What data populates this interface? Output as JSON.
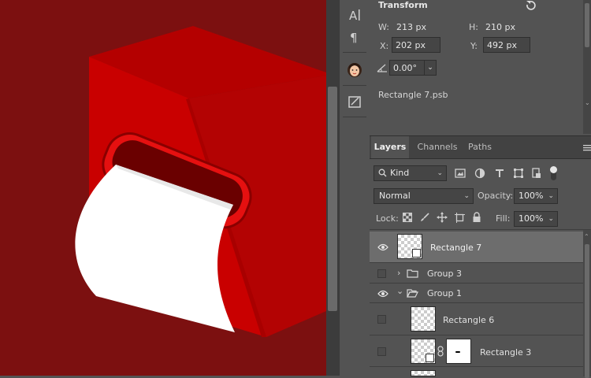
{
  "properties": {
    "section_title": "Transform",
    "w_label": "W:",
    "w_value": "213 px",
    "h_label": "H:",
    "h_value": "210 px",
    "x_label": "X:",
    "x_value": "202 px",
    "y_label": "Y:",
    "y_value": "492 px",
    "angle_value": "0.00°",
    "linked_file": "Rectangle 7.psb"
  },
  "layers_panel": {
    "tabs": [
      "Layers",
      "Channels",
      "Paths"
    ],
    "filter_kind": "Kind",
    "blend_mode": "Normal",
    "opacity_label": "Opacity:",
    "opacity_value": "100%",
    "lock_label": "Lock:",
    "fill_label": "Fill:",
    "fill_value": "100%",
    "layers": [
      {
        "name": "Rectangle 7",
        "visible": true,
        "selected": true,
        "kind": "smart-object"
      },
      {
        "name": "Group 3",
        "visible": false,
        "kind": "group",
        "expanded": false
      },
      {
        "name": "Group 1",
        "visible": true,
        "kind": "group",
        "expanded": true
      },
      {
        "name": "Rectangle 6",
        "visible": false,
        "kind": "layer"
      },
      {
        "name": "Rectangle 3",
        "visible": false,
        "kind": "layer-with-mask"
      }
    ]
  },
  "colors": {
    "canvas_bg": "#7c1010",
    "box_front": "#c40000",
    "box_side": "#b00202",
    "panel_bg": "#535353",
    "selected_row": "#6d6d6d"
  }
}
